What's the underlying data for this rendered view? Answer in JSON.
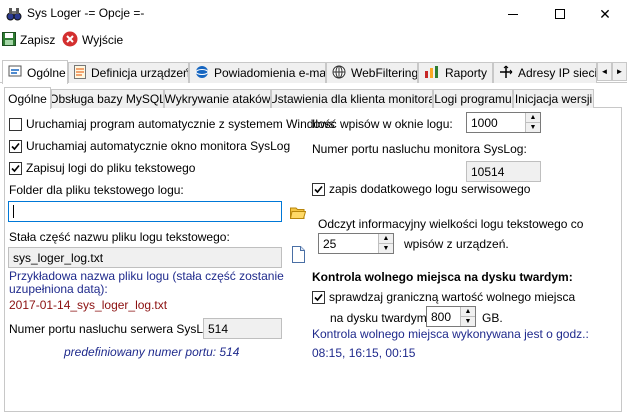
{
  "window": {
    "title": "Sys Loger -= Opcje =-",
    "minimize_glyph": "",
    "maximize_glyph": "",
    "close_glyph": "✕"
  },
  "toolbar": {
    "save_label": "Zapisz",
    "exit_label": "Wyjście"
  },
  "main_tabs": [
    {
      "label": "Ogólne",
      "icon": "wrench-icon"
    },
    {
      "label": "Definicja urządzeń",
      "icon": "document-icon"
    },
    {
      "label": "Powiadomienia e-mail",
      "icon": "globe-icon"
    },
    {
      "label": "WebFiltering",
      "icon": "web-icon"
    },
    {
      "label": "Raporty",
      "icon": "chart-icon"
    },
    {
      "label": "Adresy IP sieci w",
      "icon": "network-icon"
    }
  ],
  "main_tabs_scroll": {
    "left": "◄",
    "right": "►"
  },
  "sub_tabs": [
    "Ogólne",
    "Obsługa bazy MySQL",
    "Wykrywanie ataków",
    "Ustawienia dla klienta monitora",
    "Logi programu",
    "Inicjacja wersji"
  ],
  "general": {
    "autostart": {
      "label": "Uruchamiaj program automatycznie z systemem Windows",
      "checked": false
    },
    "autostart_monitor": {
      "label": "Uruchamiaj automatycznie okno monitora SysLog",
      "checked": true
    },
    "save_text_logs": {
      "label": "Zapisuj logi do pliku tekstowego",
      "checked": true
    },
    "folder_label": "Folder dla pliku tekstowego logu:",
    "folder_value": "",
    "fixed_name_label": "Stała część nazwu pliku logu tekstowego:",
    "fixed_name_value": "sys_loger_log.txt",
    "example_label": "Przykładowa nazwa pliku logu (stała część zostanie uzupełniona datą):",
    "example_value": "2017-01-14_sys_loger_log.txt",
    "server_port_label": "Numer portu nasluchu serwera SysLog:",
    "server_port_value": "514",
    "default_port_note": "predefiniowany numer portu: 514",
    "log_window_entries_label": "Ilość wpisów w oknie logu:",
    "log_window_entries_value": "1000",
    "monitor_port_label": "Numer portu nasluchu monitora SysLog:",
    "monitor_port_value": "10514",
    "service_log": {
      "label": "zapis dodatkowego logu serwisowego",
      "checked": true
    },
    "read_size_label": "Odczyt informacyjny wielkości logu tekstowego co",
    "read_size_value": "25",
    "read_size_suffix": "wpisów z urządzeń.",
    "disk_header": "Kontrola wolnego miejsca na dysku twardym:",
    "check_free": {
      "label": "sprawdzaj graniczną wartość wolnego miejsca",
      "checked": true
    },
    "disk_label": "na dysku twardym:",
    "disk_value": "800",
    "disk_unit": "GB.",
    "check_time_label": "Kontrola wolnego miejsca wykonywana jest o godz.:",
    "check_times": "08:15, 16:15, 00:15"
  }
}
